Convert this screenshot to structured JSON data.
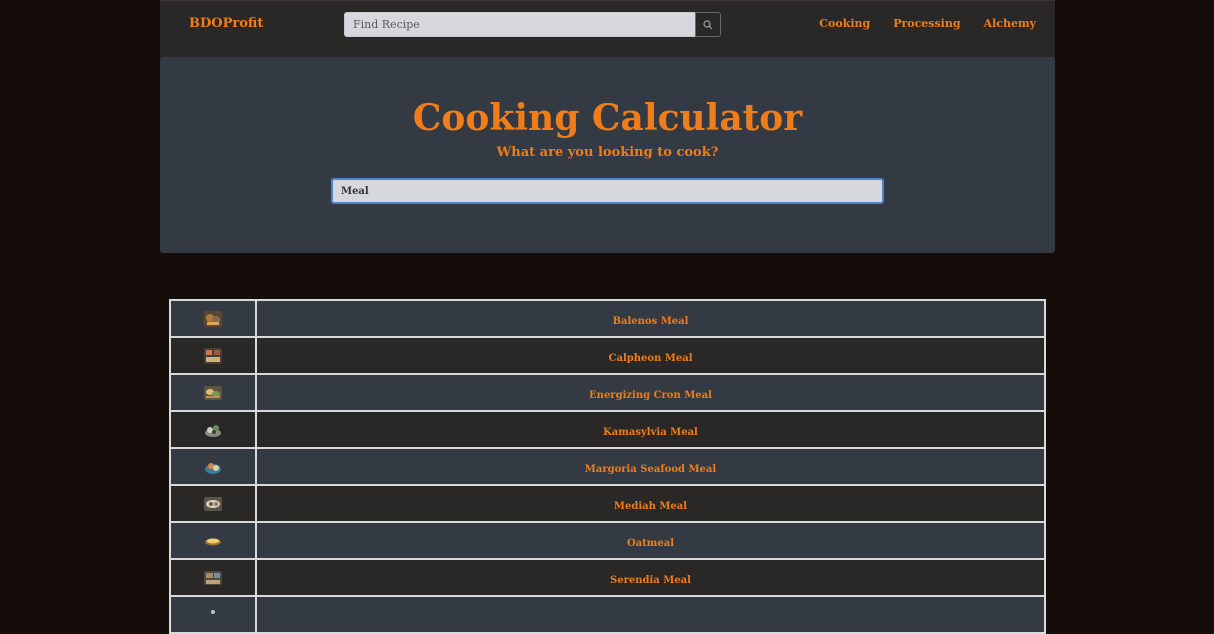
{
  "navbar": {
    "brand": "BDOProfit",
    "search_placeholder": "Find Recipe",
    "search_icon": "search-icon",
    "links": [
      "Cooking",
      "Processing",
      "Alchemy"
    ]
  },
  "hero": {
    "title": "Cooking Calculator",
    "subtitle": "What are you looking to cook?",
    "query": "Meal"
  },
  "results": [
    {
      "name": "Balenos Meal",
      "icon": "balenos-meal-icon"
    },
    {
      "name": "Calpheon Meal",
      "icon": "calpheon-meal-icon"
    },
    {
      "name": "Energizing Cron Meal",
      "icon": "energizing-cron-meal-icon"
    },
    {
      "name": "Kamasylvia Meal",
      "icon": "kamasylvia-meal-icon"
    },
    {
      "name": "Margoria Seafood Meal",
      "icon": "margoria-seafood-meal-icon"
    },
    {
      "name": "Mediah Meal",
      "icon": "mediah-meal-icon"
    },
    {
      "name": "Oatmeal",
      "icon": "oatmeal-icon"
    },
    {
      "name": "Serendia Meal",
      "icon": "serendia-meal-icon"
    },
    {
      "name": "",
      "icon": "partial-row-icon"
    }
  ],
  "colors": {
    "accent": "#f07d1a",
    "background": "#140d09",
    "navbar": "#2a2826",
    "hero": "#343a43",
    "row_odd": "#343a43",
    "row_even": "#292826"
  }
}
